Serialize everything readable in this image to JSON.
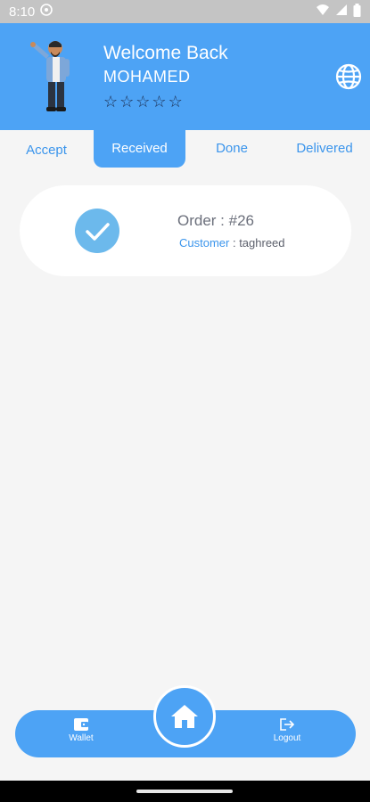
{
  "status_bar": {
    "time": "8:10"
  },
  "header": {
    "welcome": "Welcome Back",
    "username": "MOHAMED",
    "rating_stars": [
      "☆",
      "☆",
      "☆",
      "☆",
      "☆"
    ]
  },
  "tabs": [
    {
      "label": "Accept"
    },
    {
      "label": "Received"
    },
    {
      "label": "Done"
    },
    {
      "label": "Delivered"
    }
  ],
  "order_card": {
    "order_title": "Order : #26",
    "customer_label": "Customer",
    "customer_name": " : taghreed"
  },
  "bottom_nav": {
    "wallet": "Wallet",
    "logout": "Logout"
  },
  "colors": {
    "primary": "#4da3f5",
    "check": "#6cb9ec"
  }
}
